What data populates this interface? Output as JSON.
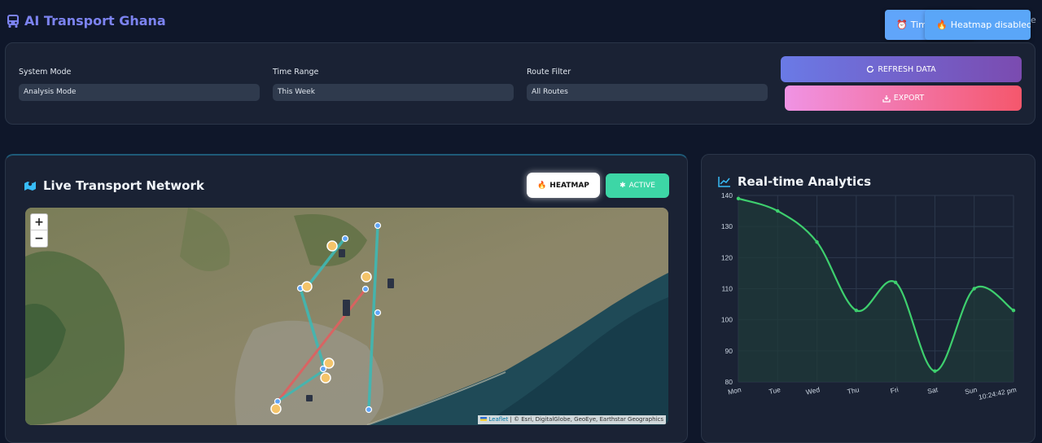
{
  "header": {
    "title": "AI Transport Ghana",
    "toast_time": "Tim",
    "toast_heatmap": "Heatmap disabled",
    "toast_edge": "e"
  },
  "controls": {
    "system_mode": {
      "label": "System Mode",
      "value": "Analysis Mode"
    },
    "time_range": {
      "label": "Time Range",
      "value": "This Week"
    },
    "route_filter": {
      "label": "Route Filter",
      "value": "All Routes"
    },
    "refresh_label": "REFRESH DATA",
    "export_label": "EXPORT"
  },
  "map_panel": {
    "title": "Live Transport Network",
    "heatmap_label": "HEATMAP",
    "active_label": "ACTIVE",
    "zoom_in": "+",
    "zoom_out": "−",
    "attribution_link": "Leaflet",
    "attribution_text": " | © Esri, DigitalGlobe, GeoEye, Earthstar Geographics"
  },
  "analytics": {
    "title": "Real-time Analytics"
  },
  "chart_data": {
    "type": "area",
    "categories": [
      "Mon",
      "Tue",
      "Wed",
      "Thu",
      "Fri",
      "Sat",
      "Sun",
      "10:24:42 pm"
    ],
    "values": [
      139,
      135,
      125,
      103,
      112,
      83.5,
      110,
      103
    ],
    "ylim": [
      80,
      140
    ],
    "yticks": [
      80,
      90,
      100,
      110,
      120,
      130,
      140
    ],
    "grid": true,
    "line_color": "#3ecf6e",
    "fill_color": "#1f3a38"
  },
  "colors": {
    "bg": "#0f172a",
    "panel": "#1a2234",
    "brand": "#7c83f0",
    "route_teal": "#3fb8b4",
    "route_red": "#e06060"
  }
}
